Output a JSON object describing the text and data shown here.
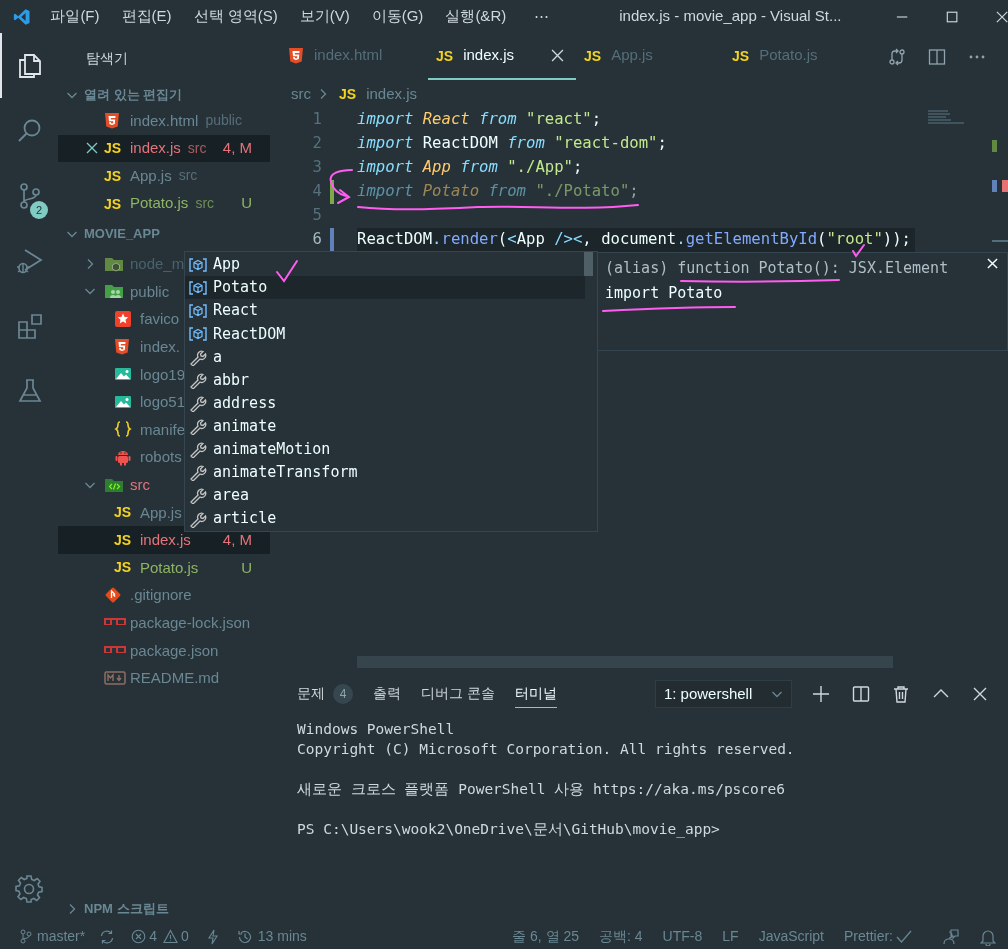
{
  "title_bar": {
    "menus": [
      "파일(F)",
      "편집(E)",
      "선택 영역(S)",
      "보기(V)",
      "이동(G)",
      "실행(&R)"
    ],
    "more": "⋯",
    "title": "index.js - movie_app - Visual St..."
  },
  "activity_bar": {
    "items": [
      {
        "kind": "explorer",
        "selected": true
      },
      {
        "kind": "search",
        "selected": false
      },
      {
        "kind": "source_control",
        "selected": false,
        "badge": "2"
      },
      {
        "kind": "run",
        "selected": false
      },
      {
        "kind": "extensions",
        "selected": false
      },
      {
        "kind": "testing",
        "selected": false
      }
    ]
  },
  "sidebar": {
    "title": "탐색기",
    "open_editors": {
      "title": "열려 있는 편집기",
      "expanded": true,
      "items": [
        {
          "kind": "html",
          "name": "index.html",
          "folder": "public",
          "color": "#6a8794",
          "selected": false
        },
        {
          "kind": "js",
          "icon_label": "JS",
          "name": "index.js",
          "folder": "src",
          "color": "#e5737a",
          "decoration": "4, M",
          "selected": true
        },
        {
          "kind": "js",
          "icon_label": "JS",
          "name": "App.js",
          "folder": "src",
          "color": "#6a8794",
          "selected": false
        },
        {
          "kind": "js",
          "icon_label": "JS",
          "name": "Potato.js",
          "folder": "src",
          "color": "#8fb464",
          "decoration": "U",
          "selected": false
        }
      ]
    },
    "project": {
      "title": "MOVIE_APP",
      "expanded": true,
      "tree": [
        {
          "name": "node_m",
          "kind": "node_folder",
          "expanded": false,
          "color": "#4a626d",
          "selected": false
        },
        {
          "name": "public",
          "kind": "public_folder",
          "expanded": true,
          "color": "#6a8794",
          "selected": false,
          "children": [
            {
              "name": "favico",
              "kind": "star",
              "color": "#6a8794",
              "selected": false
            },
            {
              "name": "index.",
              "kind": "html",
              "color": "#6a8794",
              "selected": false
            },
            {
              "name": "logo19",
              "kind": "image",
              "color": "#6a8794",
              "selected": false
            },
            {
              "name": "logo51",
              "kind": "image",
              "color": "#6a8794",
              "selected": false
            },
            {
              "name": "manife",
              "kind": "braces",
              "color": "#6a8794",
              "selected": false
            },
            {
              "name": "robots",
              "kind": "robot",
              "color": "#6a8794",
              "selected": false
            }
          ]
        },
        {
          "name": "src",
          "kind": "src_folder",
          "expanded": true,
          "color": "#e5737a",
          "selected": false,
          "children": [
            {
              "name": "App.js",
              "kind": "js",
              "icon_label": "JS",
              "color": "#6a8794",
              "selected": false
            },
            {
              "name": "index.js",
              "kind": "js",
              "icon_label": "JS",
              "color": "#e5737a",
              "decoration": "4, M",
              "selected": true
            },
            {
              "name": "Potato.js",
              "kind": "js",
              "icon_label": "JS",
              "color": "#8fb464",
              "decoration": "U",
              "selected": false
            }
          ]
        },
        {
          "name": ".gitignore",
          "kind": "git",
          "color": "#6a8794",
          "selected": false
        },
        {
          "name": "package-lock.json",
          "kind": "npm",
          "color": "#6a8794",
          "selected": false
        },
        {
          "name": "package.json",
          "kind": "npm",
          "color": "#6a8794",
          "selected": false
        },
        {
          "name": "README.md",
          "kind": "markdown",
          "color": "#6a8794",
          "selected": false
        }
      ]
    },
    "npm_scripts": {
      "title": "NPM 스크립트",
      "expanded": false
    }
  },
  "editor": {
    "tabs": [
      {
        "kind": "html",
        "label": "index.html",
        "selected": false
      },
      {
        "kind": "js",
        "icon_label": "JS",
        "label": "index.js",
        "selected": true
      },
      {
        "kind": "js",
        "icon_label": "JS",
        "label": "App.js",
        "selected": false
      },
      {
        "kind": "js",
        "icon_label": "JS",
        "label": "Potato.js",
        "selected": false
      }
    ],
    "breadcrumb": {
      "folder": "src",
      "icon_label": "JS",
      "file": "index.js"
    },
    "lines": [
      {
        "number": "1",
        "current": false,
        "faded": false,
        "tokens": [
          {
            "text": "import ",
            "kind": "keyword"
          },
          {
            "text": "React ",
            "kind": "variable"
          },
          {
            "text": "from ",
            "kind": "keyword"
          },
          {
            "text": "\"react\"",
            "kind": "string"
          },
          {
            "text": ";",
            "kind": "plain"
          }
        ]
      },
      {
        "number": "2",
        "current": false,
        "faded": false,
        "tokens": [
          {
            "text": "import ",
            "kind": "keyword"
          },
          {
            "text": "ReactDOM ",
            "kind": "plain"
          },
          {
            "text": "from ",
            "kind": "keyword"
          },
          {
            "text": "\"react-dom\"",
            "kind": "string"
          },
          {
            "text": ";",
            "kind": "plain"
          }
        ]
      },
      {
        "number": "3",
        "current": false,
        "faded": false,
        "tokens": [
          {
            "text": "import ",
            "kind": "keyword"
          },
          {
            "text": "App ",
            "kind": "variable"
          },
          {
            "text": "from ",
            "kind": "keyword"
          },
          {
            "text": "\"./App\"",
            "kind": "string"
          },
          {
            "text": ";",
            "kind": "plain"
          }
        ]
      },
      {
        "number": "4",
        "current": false,
        "faded": true,
        "change_marker": {
          "color": "#7fa84a"
        },
        "tokens": [
          {
            "text": "import ",
            "kind": "keyword"
          },
          {
            "text": "Potato ",
            "kind": "variable"
          },
          {
            "text": "from ",
            "kind": "keyword"
          },
          {
            "text": "\"./Potato\"",
            "kind": "string"
          },
          {
            "text": ";",
            "kind": "plain"
          }
        ]
      },
      {
        "number": "5",
        "current": false
      },
      {
        "number": "6",
        "current": true,
        "faded": false,
        "change_marker": {
          "color": "#6182b8"
        },
        "tokens": [
          {
            "text": "ReactDOM",
            "kind": "plain"
          },
          {
            "text": ".",
            "kind": "punct"
          },
          {
            "text": "render",
            "kind": "func"
          },
          {
            "text": "(",
            "kind": "plain"
          },
          {
            "text": "<",
            "kind": "punct"
          },
          {
            "text": "App ",
            "kind": "plain"
          },
          {
            "text": "/>",
            "kind": "punct"
          },
          {
            "text": "<",
            "kind": "punct"
          },
          {
            "text": ", document",
            "kind": "plain"
          },
          {
            "text": ".",
            "kind": "punct"
          },
          {
            "text": "getElementById",
            "kind": "func"
          },
          {
            "text": "(",
            "kind": "plain"
          },
          {
            "text": "\"root\"",
            "kind": "string"
          },
          {
            "text": "));",
            "kind": "plain"
          }
        ]
      }
    ]
  },
  "suggest": {
    "items": [
      {
        "kind": "variable",
        "label": "App",
        "selected": false
      },
      {
        "kind": "variable",
        "label": "Potato",
        "selected": true
      },
      {
        "kind": "variable",
        "label": "React",
        "selected": false
      },
      {
        "kind": "variable",
        "label": "ReactDOM",
        "selected": false
      },
      {
        "kind": "snippet",
        "label": "a",
        "selected": false
      },
      {
        "kind": "snippet",
        "label": "abbr",
        "selected": false
      },
      {
        "kind": "snippet",
        "label": "address",
        "selected": false
      },
      {
        "kind": "snippet",
        "label": "animate",
        "selected": false
      },
      {
        "kind": "snippet",
        "label": "animateMotion",
        "selected": false
      },
      {
        "kind": "snippet",
        "label": "animateTransform",
        "selected": false
      },
      {
        "kind": "snippet",
        "label": "area",
        "selected": false
      },
      {
        "kind": "snippet",
        "label": "article",
        "selected": false
      }
    ],
    "detail": {
      "signature": "(alias) function Potato(): JSX.Element",
      "import": "import Potato"
    }
  },
  "panel": {
    "tabs": [
      {
        "label": "문제",
        "badge": "4",
        "selected": false
      },
      {
        "label": "출력",
        "selected": false
      },
      {
        "label": "디버그 콘솔",
        "selected": false
      },
      {
        "label": "터미널",
        "selected": true
      }
    ],
    "terminal_select": "1: powershell",
    "terminal_blocks": [
      [
        "Windows PowerShell",
        "Copyright (C) Microsoft Corporation. All rights reserved."
      ],
      [
        "새로운 크로스 플랫폼 PowerShell 사용 https://aka.ms/pscore6"
      ],
      [
        "PS C:\\Users\\wook2\\OneDrive\\문서\\GitHub\\movie_app>"
      ]
    ]
  },
  "status_bar": {
    "branch": "master*",
    "errors": "4",
    "warnings": "0",
    "history": "13 mins",
    "cursor": "줄 6, 열 25",
    "indent": "공백: 4",
    "encoding": "UTF-8",
    "eol": "LF",
    "language": "JavaScript",
    "formatter": "Prettier:"
  }
}
